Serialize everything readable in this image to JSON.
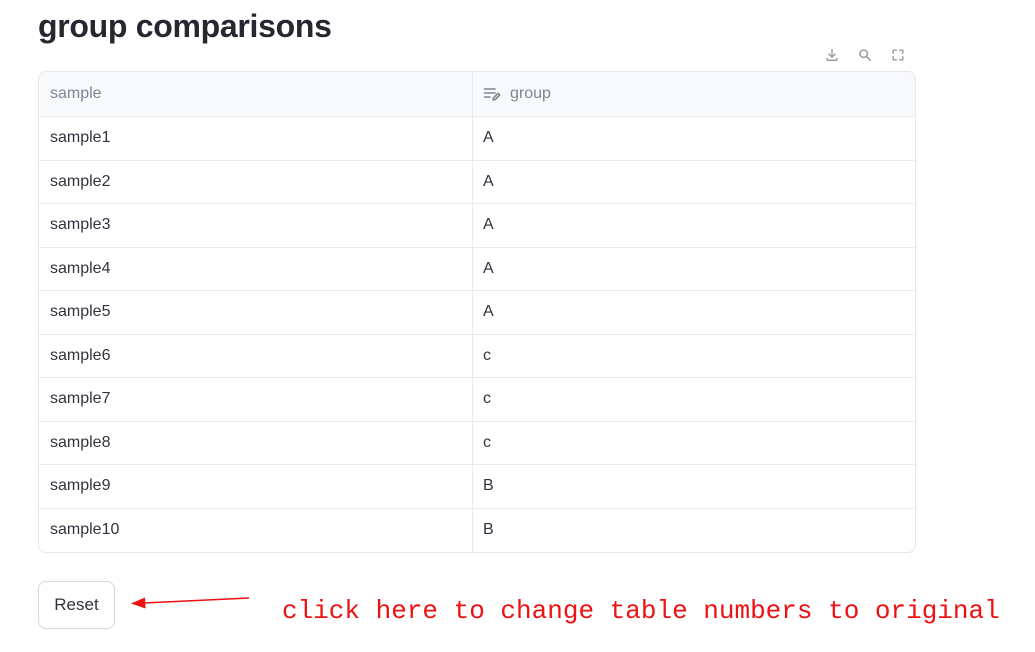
{
  "page": {
    "title": "group comparisons"
  },
  "toolbar": {
    "icons": [
      "download-icon",
      "search-icon",
      "fullscreen-icon"
    ]
  },
  "table": {
    "columns": [
      "sample",
      "group"
    ],
    "rows": [
      [
        "sample1",
        "A"
      ],
      [
        "sample2",
        "A"
      ],
      [
        "sample3",
        "A"
      ],
      [
        "sample4",
        "A"
      ],
      [
        "sample5",
        "A"
      ],
      [
        "sample6",
        "c"
      ],
      [
        "sample7",
        "c"
      ],
      [
        "sample8",
        "c"
      ],
      [
        "sample9",
        "B"
      ],
      [
        "sample10",
        "B"
      ]
    ]
  },
  "reset_button": {
    "label": "Reset"
  },
  "annotation": {
    "text": "click here to change table numbers to original",
    "color": "#ee1111"
  },
  "colors": {
    "accent_red": "#ee1111",
    "header_bg": "#f8f9fb",
    "border": "#e6e6eb"
  }
}
